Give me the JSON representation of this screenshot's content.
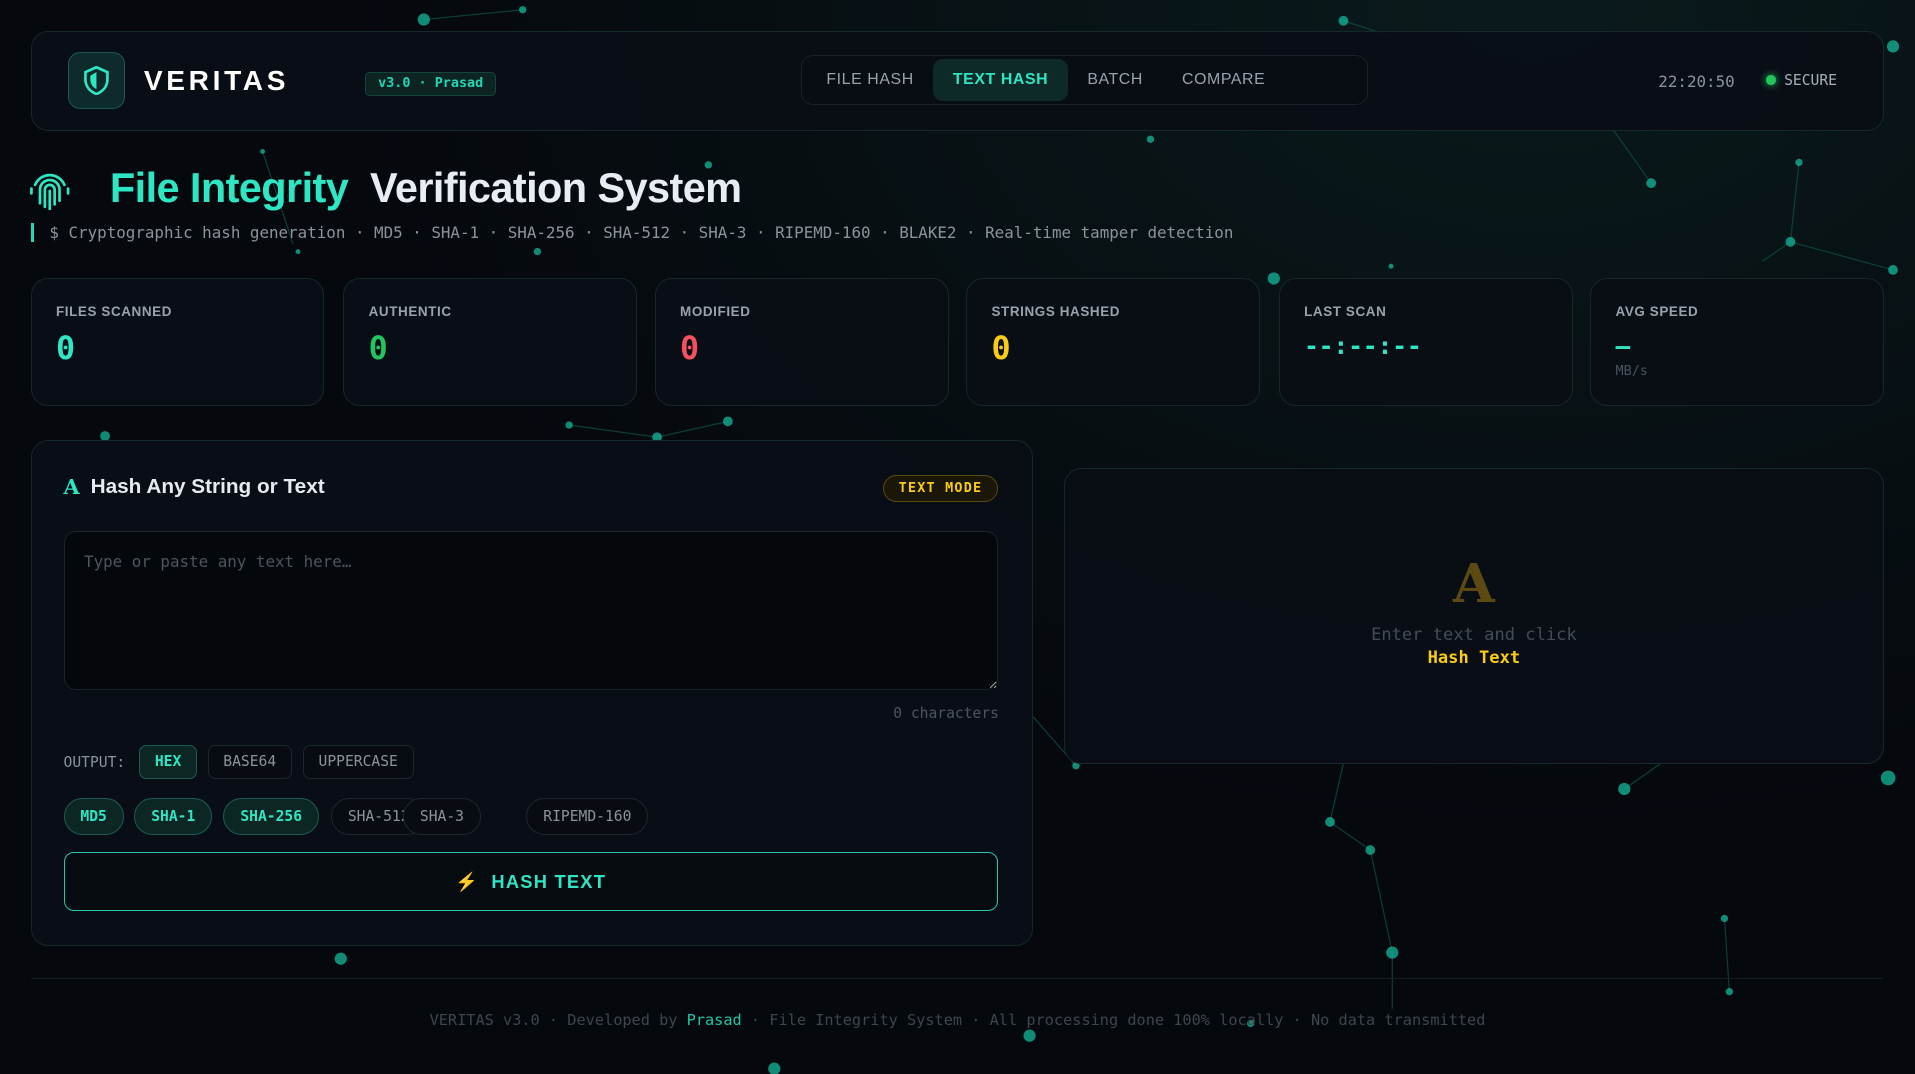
{
  "header": {
    "brand": "VERITAS",
    "version": "v3.0 · Prasad",
    "nav": [
      {
        "label": "FILE HASH"
      },
      {
        "label": "TEXT HASH",
        "active": true
      },
      {
        "label": "BATCH"
      },
      {
        "label": "COMPARE"
      }
    ],
    "time": "22:20:50",
    "status": "SECURE"
  },
  "hero": {
    "title_accent": "File Integrity",
    "title_rest": "Verification System",
    "subtitle": "$ Cryptographic hash generation · MD5 · SHA-1 · SHA-256 · SHA-512 · SHA-3 · RIPEMD-160 · BLAKE2 · Real-time tamper detection"
  },
  "stats": [
    {
      "label": "FILES SCANNED",
      "value": "0",
      "color": "#2ee6c3"
    },
    {
      "label": "AUTHENTIC",
      "value": "0",
      "color": "#22c55e"
    },
    {
      "label": "MODIFIED",
      "value": "0",
      "color": "#f4505f"
    },
    {
      "label": "STRINGS HASHED",
      "value": "0",
      "color": "#facc15"
    },
    {
      "label": "LAST SCAN",
      "value": "--:--:--",
      "color": "#2ee6c3"
    },
    {
      "label": "AVG SPEED",
      "value": "–",
      "unit": "MB/s",
      "color": "#2ee6c3"
    }
  ],
  "text_panel": {
    "title": "Hash Any String or Text",
    "badge": "TEXT MODE",
    "placeholder": "Type or paste any text here…",
    "value": "",
    "char_count": "0 characters",
    "output_label": "OUTPUT:",
    "output_formats": [
      {
        "label": "HEX",
        "selected": true
      },
      {
        "label": "BASE64",
        "selected": false
      },
      {
        "label": "UPPERCASE",
        "selected": false
      }
    ],
    "algorithms": [
      {
        "label": "MD5",
        "selected": true
      },
      {
        "label": "SHA-1",
        "selected": true
      },
      {
        "label": "SHA-256",
        "selected": true
      },
      {
        "label": "SHA-512",
        "selected": false
      },
      {
        "label": "SHA-3",
        "selected": false
      },
      {
        "label": "RIPEMD-160",
        "selected": false
      }
    ],
    "button": "HASH TEXT"
  },
  "result_panel": {
    "icon_glyph": "A",
    "hint": "Enter text and click",
    "hint_action": "Hash Text"
  },
  "footer": {
    "pre": "VERITAS v3.0 · Developed by ",
    "author": "Prasad",
    "post": " · File Integrity System · All processing done 100% locally · No data transmitted"
  }
}
